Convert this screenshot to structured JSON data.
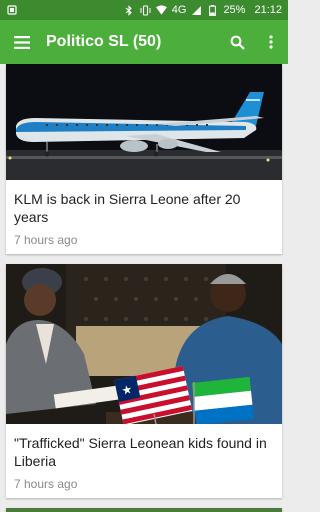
{
  "status_bar": {
    "battery": "25%",
    "time": "21:12",
    "network": "4G",
    "icons": [
      "notification-icon",
      "bluetooth-icon",
      "vibrate-icon",
      "wifi-icon",
      "signal-icon",
      "battery-icon"
    ]
  },
  "app_bar": {
    "title": "Politico SL (50)",
    "icons": [
      "menu-icon",
      "search-icon",
      "more-vert-icon"
    ]
  },
  "articles": [
    {
      "headline": "KLM is back in Sierra Leone after 20 years",
      "time": "7 hours ago",
      "image": "klm-airplane-at-night"
    },
    {
      "headline": "\"Trafficked\" Sierra Leonean kids found in Liberia",
      "time": "7 hours ago",
      "image": "presidents-meeting-with-flags"
    }
  ],
  "colors": {
    "primary": "#4caf3b",
    "status_bar": "#3d8b2f",
    "background": "#ececec"
  }
}
